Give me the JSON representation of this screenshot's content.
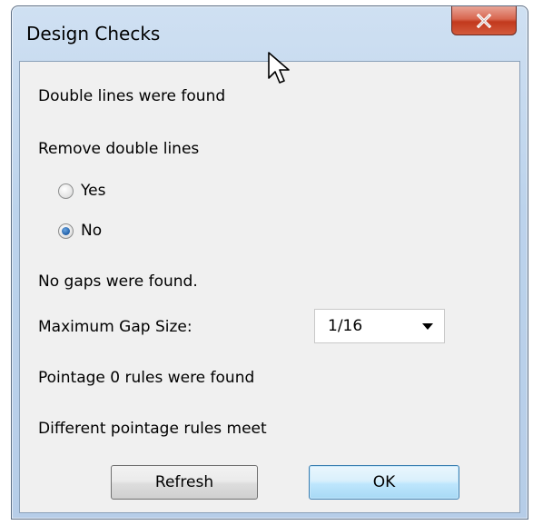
{
  "window": {
    "title": "Design Checks",
    "close_label": "X"
  },
  "content": {
    "double_lines_status": "Double lines were found",
    "remove_double_lines_label": "Remove double lines",
    "radio_options": [
      {
        "label": "Yes",
        "checked": false
      },
      {
        "label": "No",
        "checked": true
      }
    ],
    "gaps_status": "No gaps were found.",
    "max_gap_label": "Maximum Gap Size:",
    "max_gap_value": "1/16",
    "pointage_status": "Pointage 0 rules were found",
    "pointage_meet_status": "Different pointage rules meet"
  },
  "buttons": {
    "refresh": "Refresh",
    "ok": "OK"
  },
  "colors": {
    "titlebar": "#bcd3ec",
    "close_button": "#c2391d",
    "content_bg": "#f0f0f0",
    "ok_border": "#3c7fb1"
  },
  "icons": {
    "cursor": "arrow-cursor-icon",
    "close": "close-icon",
    "dropdown": "chevron-down-icon"
  }
}
